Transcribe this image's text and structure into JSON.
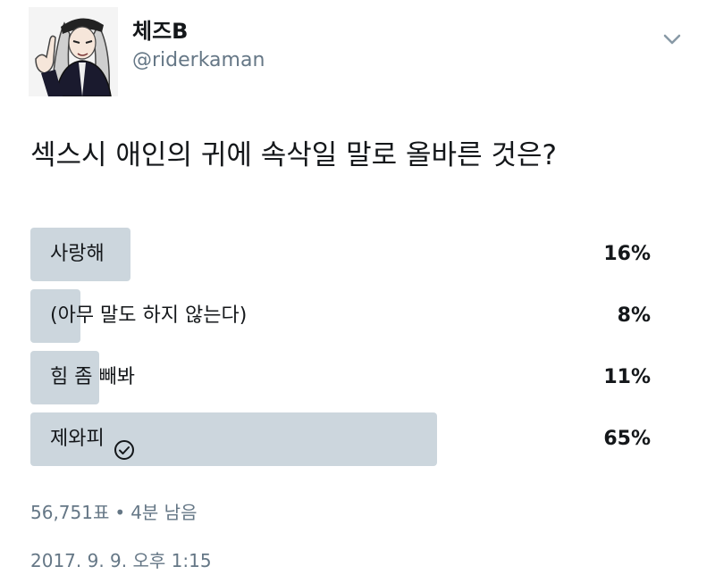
{
  "tweet": {
    "display_name": "체즈B",
    "handle": "@riderkaman",
    "question": "섹스시 애인의 귀에 속삭일 말로 올바른 것은?"
  },
  "poll": {
    "options": [
      {
        "label": "사랑해",
        "percent_text": "16%",
        "percent": 16,
        "selected": false
      },
      {
        "label": "(아무 말도 하지 않는다)",
        "percent_text": "8%",
        "percent": 8,
        "selected": false
      },
      {
        "label": "힘 좀 빼봐",
        "percent_text": "11%",
        "percent": 11,
        "selected": false
      },
      {
        "label": "제와피",
        "percent_text": "65%",
        "percent": 65,
        "selected": true
      }
    ],
    "votes_text": "56,751표",
    "separator": "•",
    "time_left_text": "4분 남음"
  },
  "timestamp": "2017. 9. 9. 오후 1:15",
  "colors": {
    "bar": "#ccd6dd",
    "secondary_text": "#657786",
    "primary_text": "#14171a"
  },
  "icons": {
    "menu": "chevron-down-icon",
    "winner": "check-circle-icon"
  }
}
